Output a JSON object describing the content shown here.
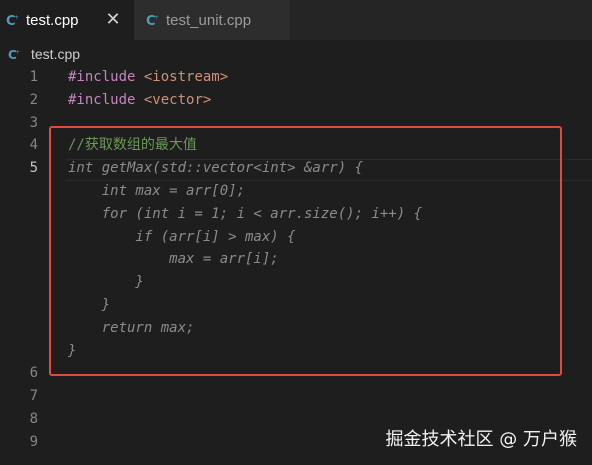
{
  "tabs": [
    {
      "label": "test.cpp",
      "active": true
    },
    {
      "label": "test_unit.cpp",
      "active": false
    }
  ],
  "breadcrumb": {
    "file": "test.cpp"
  },
  "editor": {
    "current_line": 5,
    "lines": [
      {
        "n": "1",
        "text": "#include <iostream>"
      },
      {
        "n": "2",
        "text": "#include <vector>"
      },
      {
        "n": "3",
        "text": ""
      },
      {
        "n": "4",
        "text": "//获取数组的最大值"
      },
      {
        "n": "5",
        "text": "int getMax(std::vector<int> &arr) {"
      },
      {
        "n": "",
        "text": "    int max = arr[0];"
      },
      {
        "n": "",
        "text": "    for (int i = 1; i < arr.size(); i++) {"
      },
      {
        "n": "",
        "text": "        if (arr[i] > max) {"
      },
      {
        "n": "",
        "text": "            max = arr[i];"
      },
      {
        "n": "",
        "text": "        }"
      },
      {
        "n": "",
        "text": "    }"
      },
      {
        "n": "",
        "text": "    return max;"
      },
      {
        "n": "",
        "text": "}"
      },
      {
        "n": "6",
        "text": ""
      },
      {
        "n": "7",
        "text": ""
      },
      {
        "n": "8",
        "text": ""
      },
      {
        "n": "9",
        "text": ""
      }
    ]
  },
  "watermark": "掘金技术社区 @ 万户猴",
  "colors": {
    "accent_icon": "#519aba",
    "highlight_box": "#e04b3f",
    "comment": "#6a9955",
    "preprocessor": "#c586c0",
    "include_path": "#ce9178"
  }
}
